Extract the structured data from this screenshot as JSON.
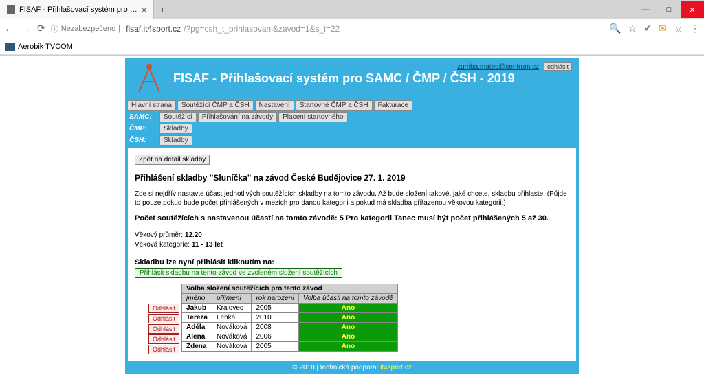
{
  "browser": {
    "tab_title": "FISAF - Přihlašovací systém pro …",
    "new_tab_glyph": "+",
    "security_label": "Nezabezpečeno",
    "url_domain": "fisaf.it4sport.cz",
    "url_path": "/?pg=csh_t_prihlasovani&zavod=1&s_i=22",
    "bookmark_label": "Aerobik TVCOM"
  },
  "header": {
    "title": "FISAF - Přihlašovací systém pro SAMC / ČMP / ČSH - 2019",
    "user_email": "zumba.mates@centrum.cz",
    "logout_label": "odhlásit"
  },
  "nav": {
    "row1": [
      "Hlavní strana",
      "Soutěžící ČMP a ČSH",
      "Nastavení",
      "Startovné ČMP a ČSH",
      "Fakturace"
    ],
    "samc_label": "SAMC:",
    "samc_items": [
      "Soutěžící",
      "Přihlašování na závody",
      "Placení startovného"
    ],
    "cmp_label": "ČMP:",
    "cmp_items": [
      "Skladby"
    ],
    "csh_label": "ČSH:",
    "csh_items": [
      "Skladby"
    ]
  },
  "content": {
    "back_label": "Zpět na detail skladby",
    "page_heading": "Přihlášení skladby \"Sluníčka\" na závod České Budějovice 27. 1. 2019",
    "intro": "Zde si nejdřív nastavte účast jednotlivých soutěžících skladby na tomto závodu. Až bude složení takové, jaké chcete, skladbu přihlaste. (Půjde to pouze pokud bude počet přihlášených v mezích pro danou kategorii a pokud má skladba přiřazenou věkovou kategorii.)",
    "count_line_p1": "Počet soutěžících s nastavenou účastí na tomto závodě: ",
    "count_value": "5",
    "count_line_p2": " Pro kategorii Tanec musí být počet přihlášených ",
    "count_range": "5 až 30",
    "count_line_p3": ".",
    "age_avg_label": "Věkový průměr: ",
    "age_avg_value": "12.20",
    "age_cat_label": "Věková kategorie: ",
    "age_cat_value": "11 - 13 let",
    "register_heading": "Skladbu lze nyní přihlásit kliknutím na:",
    "register_btn": "Přihlásit skladbu na tento závod ve zvoleném složení soutěžících"
  },
  "table": {
    "title": "Volba složení soutěžících pro tento závod",
    "cols": {
      "firstname": "jméno",
      "lastname": "příjmení",
      "year": "rok narození",
      "participation": "Volba účasti na tomto závodě"
    },
    "odhlasit_label": "Odhlásit",
    "rows": [
      {
        "firstname": "Jakub",
        "lastname": "Kralovec",
        "year": "2005",
        "participation": "Ano"
      },
      {
        "firstname": "Tereza",
        "lastname": "Lehká",
        "year": "2010",
        "participation": "Ano"
      },
      {
        "firstname": "Adéla",
        "lastname": "Nováková",
        "year": "2008",
        "participation": "Ano"
      },
      {
        "firstname": "Alena",
        "lastname": "Nováková",
        "year": "2006",
        "participation": "Ano"
      },
      {
        "firstname": "Zdena",
        "lastname": "Nováková",
        "year": "2005",
        "participation": "Ano"
      }
    ]
  },
  "footer": {
    "text": "© 2018 | technická podpora: ",
    "link": "it4sport.cz"
  }
}
